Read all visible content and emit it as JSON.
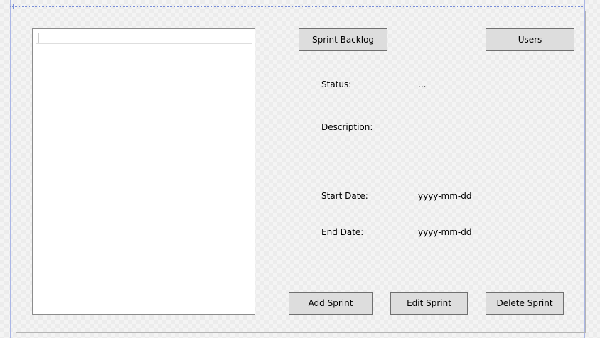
{
  "header_buttons": {
    "sprint_backlog": "Sprint Backlog",
    "users": "Users"
  },
  "details": {
    "status_label": "Status:",
    "status_value": "...",
    "description_label": "Description:",
    "start_date_label": "Start Date:",
    "start_date_value": "yyyy-mm-dd",
    "end_date_label": "End Date:",
    "end_date_value": "yyyy-mm-dd"
  },
  "actions": {
    "add_sprint": "Add Sprint",
    "edit_sprint": "Edit Sprint",
    "delete_sprint": "Delete Sprint"
  },
  "colors": {
    "button_face": "#dddddd",
    "button_border": "#707070",
    "designer_guide": "#7a8ed8",
    "panel_background": "#ffffff"
  }
}
